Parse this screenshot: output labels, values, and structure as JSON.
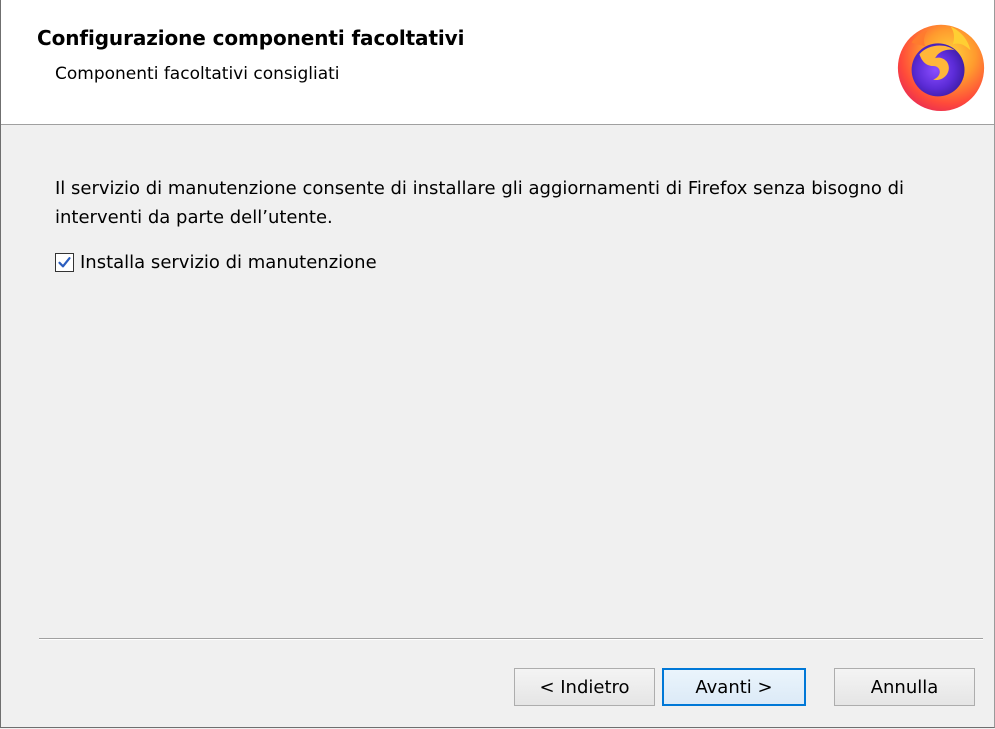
{
  "header": {
    "title": "Configurazione componenti facoltativi",
    "subtitle": "Componenti facoltativi consigliati",
    "logo_icon": "firefox-logo-icon"
  },
  "content": {
    "description": "Il servizio di manutenzione consente di installare gli aggiornamenti di Firefox senza bisogno di interventi da parte dell’utente.",
    "checkbox": {
      "label": "Installa servizio di manutenzione",
      "checked": true
    }
  },
  "buttons": {
    "back": "< Indietro",
    "next": "Avanti >",
    "cancel": "Annulla"
  },
  "colors": {
    "header_bg": "#ffffff",
    "body_bg": "#f0f0f0",
    "primary_border": "#0078d7"
  }
}
